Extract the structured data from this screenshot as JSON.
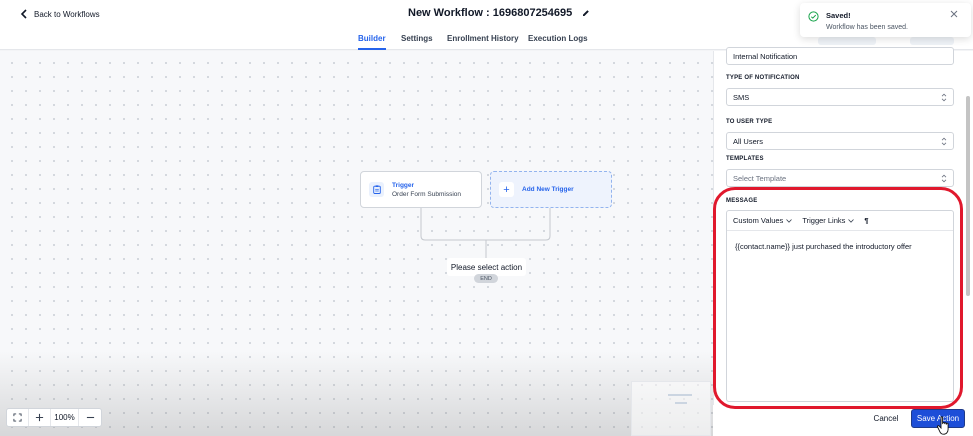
{
  "header": {
    "back_label": "Back to Workflows",
    "workflow_title": "New Workflow : 1696807254695"
  },
  "tabs": [
    {
      "label": "Builder",
      "active": true
    },
    {
      "label": "Settings",
      "active": false
    },
    {
      "label": "Enrollment History",
      "active": false
    },
    {
      "label": "Execution Logs",
      "active": false
    }
  ],
  "canvas": {
    "trigger_node": {
      "title": "Trigger",
      "subtitle": "Order Form Submission"
    },
    "add_trigger_label": "Add New Trigger",
    "select_action_label": "Please select action",
    "end_label": "END",
    "zoom_level": "100%"
  },
  "panel": {
    "action_name_value": "Internal Notification",
    "type_of_notification": {
      "label": "TYPE OF NOTIFICATION",
      "value": "SMS"
    },
    "to_user_type": {
      "label": "TO USER TYPE",
      "value": "All Users"
    },
    "templates": {
      "label": "TEMPLATES",
      "placeholder": "Select Template"
    },
    "message": {
      "label": "MESSAGE",
      "toolbar": {
        "custom_values": "Custom Values",
        "trigger_links": "Trigger Links",
        "paragraph": "¶"
      },
      "text": "{{contact.name}} just purchased the introductory offer"
    },
    "cancel_label": "Cancel",
    "save_label": "Save Action"
  },
  "toast": {
    "title": "Saved!",
    "message": "Workflow has been saved."
  },
  "colors": {
    "accent": "#2563eb",
    "save_button": "#1d4ed8",
    "highlight": "#e0182d",
    "success": "#16a34a"
  }
}
